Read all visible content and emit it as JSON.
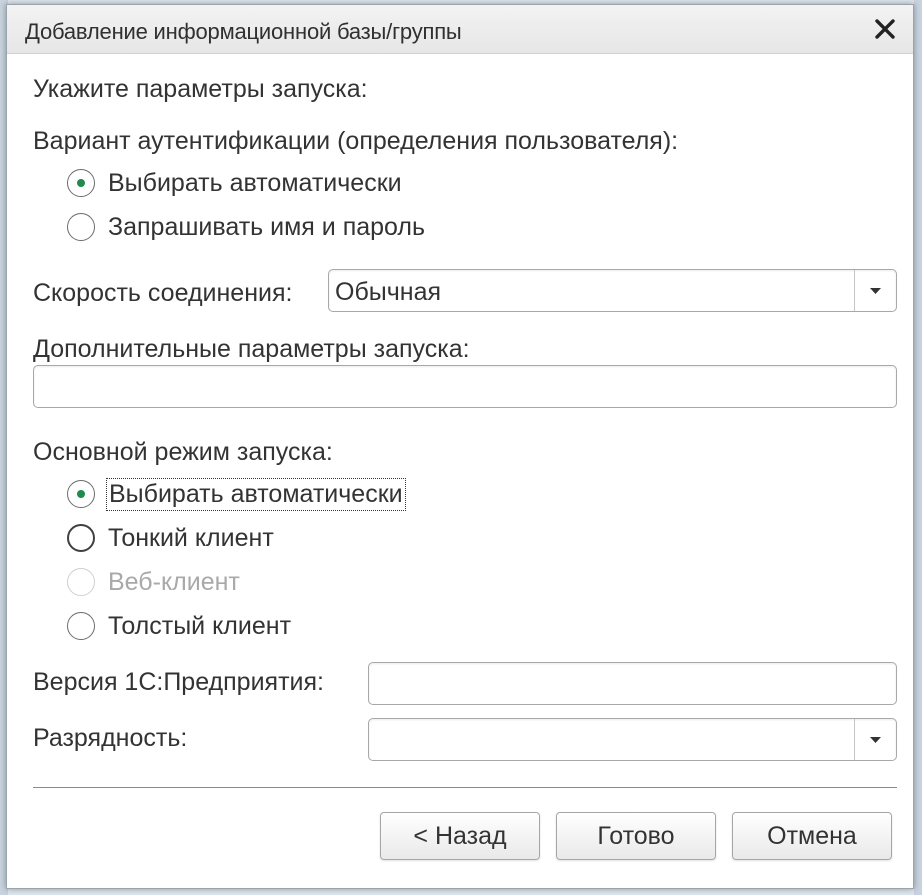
{
  "dialog": {
    "title": "Добавление информационной базы/группы",
    "close_icon": "close-icon"
  },
  "prompt": "Укажите параметры запуска:",
  "auth": {
    "label": "Вариант аутентификации (определения пользователя):",
    "options": [
      {
        "label": "Выбирать автоматически",
        "selected": true
      },
      {
        "label": "Запрашивать имя и пароль",
        "selected": false
      }
    ]
  },
  "connection_speed": {
    "label": "Скорость соединения:",
    "value": "Обычная"
  },
  "extra_params": {
    "label": "Дополнительные параметры запуска:",
    "value": ""
  },
  "launch_mode": {
    "label": "Основной режим запуска:",
    "options": [
      {
        "label": "Выбирать автоматически",
        "selected": true,
        "disabled": false
      },
      {
        "label": "Тонкий клиент",
        "selected": false,
        "disabled": false
      },
      {
        "label": "Веб-клиент",
        "selected": false,
        "disabled": true
      },
      {
        "label": "Толстый клиент",
        "selected": false,
        "disabled": false
      }
    ]
  },
  "version": {
    "label": "Версия 1С:Предприятия:",
    "value": ""
  },
  "bitness": {
    "label": "Разрядность:",
    "value": ""
  },
  "buttons": {
    "back": "< Назад",
    "finish": "Готово",
    "cancel": "Отмена"
  },
  "colors": {
    "radio_selected": "#1f8b4c",
    "disabled_text": "#a9a9a9"
  }
}
